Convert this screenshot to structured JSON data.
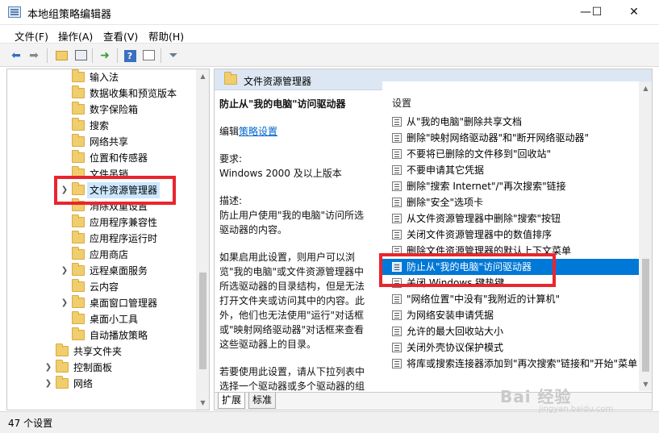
{
  "window": {
    "title": "本地组策略编辑器"
  },
  "window_controls": {
    "minimize": "—",
    "maximize": "☐",
    "close": "✕"
  },
  "menu": [
    "文件(F)",
    "操作(A)",
    "查看(V)",
    "帮助(H)"
  ],
  "toolbar": {
    "icons": [
      "back-arrow-icon",
      "forward-arrow-icon",
      "up-folder-icon",
      "show-hide-tree-icon",
      "export-list-icon",
      "help-icon",
      "properties-icon",
      "filter-icon"
    ]
  },
  "tree": {
    "items": [
      {
        "label": "输入法",
        "indent": 2,
        "expandable": false
      },
      {
        "label": "数据收集和预览版本",
        "indent": 2,
        "expandable": false
      },
      {
        "label": "数字保险箱",
        "indent": 2,
        "expandable": false
      },
      {
        "label": "搜索",
        "indent": 2,
        "expandable": false
      },
      {
        "label": "网络共享",
        "indent": 2,
        "expandable": false
      },
      {
        "label": "位置和传感器",
        "indent": 2,
        "expandable": false
      },
      {
        "label": "文件吊销",
        "indent": 2,
        "expandable": false
      },
      {
        "label": "文件资源管理器",
        "indent": 2,
        "expandable": true,
        "selected": true
      },
      {
        "label": "消除双重设置",
        "indent": 2,
        "expandable": false
      },
      {
        "label": "应用程序兼容性",
        "indent": 2,
        "expandable": false
      },
      {
        "label": "应用程序运行时",
        "indent": 2,
        "expandable": false
      },
      {
        "label": "应用商店",
        "indent": 2,
        "expandable": false
      },
      {
        "label": "远程桌面服务",
        "indent": 2,
        "expandable": true
      },
      {
        "label": "云内容",
        "indent": 2,
        "expandable": false
      },
      {
        "label": "桌面窗口管理器",
        "indent": 2,
        "expandable": true
      },
      {
        "label": "桌面小工具",
        "indent": 2,
        "expandable": false
      },
      {
        "label": "自动播放策略",
        "indent": 2,
        "expandable": false
      },
      {
        "label": "共享文件夹",
        "indent": 1,
        "expandable": false
      },
      {
        "label": "控制面板",
        "indent": 1,
        "expandable": true
      },
      {
        "label": "网络",
        "indent": 1,
        "expandable": true
      }
    ]
  },
  "right_header": {
    "title": "文件资源管理器"
  },
  "description": {
    "policy_title": "防止从\"我的电脑\"访问驱动器",
    "edit_prefix": "编辑",
    "edit_link": "策略设置",
    "requirements_label": "要求:",
    "requirements_value": "Windows 2000 及以上版本",
    "description_label": "描述:",
    "description_text": "防止用户使用\"我的电脑\"访问所选驱动器的内容。",
    "enabled_text": "如果启用此设置，则用户可以浏览\"我的电脑\"或文件资源管理器中所选驱动器的目录结构，但是无法打开文件夹或访问其中的内容。此外，他们也无法使用\"运行\"对话框或\"映射网络驱动器\"对话框来查看这些驱动器上的目录。",
    "usage_text": "若要使用此设置，请从下拉列表中选择一个驱动器或多个驱动器的组合。若要允许访问所有驱动器目"
  },
  "settings": {
    "header": "设置",
    "items": [
      "从\"我的电脑\"删除共享文档",
      "删除\"映射网络驱动器\"和\"断开网络驱动器\"",
      "不要将已删除的文件移到\"回收站\"",
      "不要申请其它凭据",
      "删除\"搜索 Internet\"/\"再次搜索\"链接",
      "删除\"安全\"选项卡",
      "从文件资源管理器中删除\"搜索\"按钮",
      "关闭文件资源管理器中的数值排序",
      "删除文件资源管理器的默认上下文菜单",
      "防止从\"我的电脑\"访问驱动器",
      "关闭 Windows 键热键",
      "\"网络位置\"中没有\"我附近的计算机\"",
      "为网络安装申请凭据",
      "允许的最大回收站大小",
      "关闭外壳协议保护模式",
      "将库或搜索连接器添加到\"再次搜索\"链接和\"开始\"菜单"
    ],
    "selected_index": 9
  },
  "tabs": [
    "扩展",
    "标准"
  ],
  "status": {
    "text": "47 个设置"
  },
  "watermark": {
    "main": "Bai 经验",
    "sub": "jingyan.baidu.com"
  },
  "colors": {
    "highlight": "#e8262d",
    "selection": "#0078d7",
    "header_bg": "#dce7f3"
  }
}
